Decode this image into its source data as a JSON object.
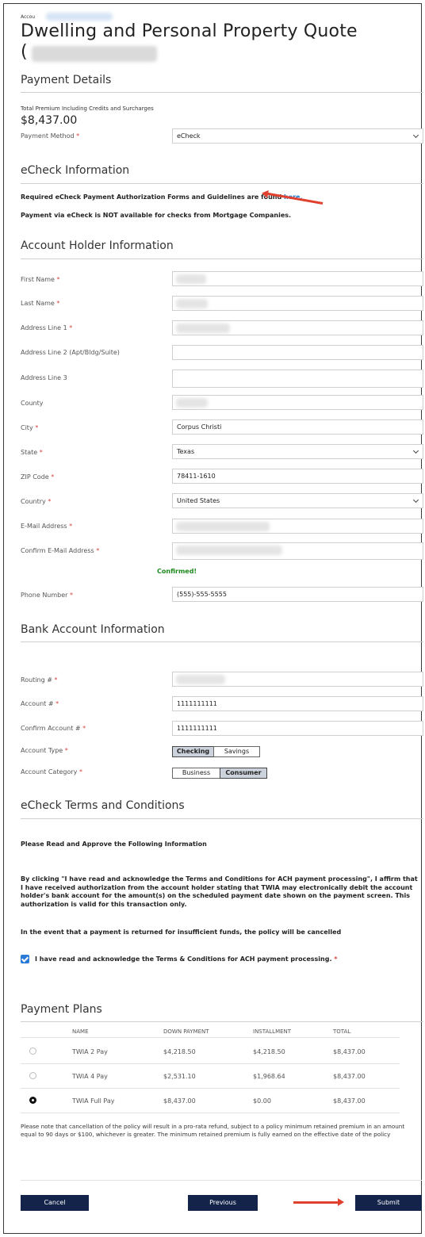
{
  "header": {
    "account_prefix": "Accou",
    "title_line1": "Dwelling and Personal Property Quote",
    "title_line2": "("
  },
  "payment_details": {
    "section_title": "Payment Details",
    "premium_label": "Total Premium Including Credits and Surcharges",
    "premium_value": "$8,437.00",
    "method_label": "Payment Method",
    "method_value": "eCheck"
  },
  "echeck_info": {
    "section_title": "eCheck Information",
    "line1_text": "Required eCheck Payment Authorization Forms and Guidelines are found ",
    "line1_link": "here.",
    "line2_text": "Payment via eCheck is NOT available for checks from Mortgage Companies."
  },
  "account_holder": {
    "section_title": "Account Holder Information",
    "fields": {
      "first_name": {
        "label": "First Name",
        "value": ""
      },
      "last_name": {
        "label": "Last Name",
        "value": ""
      },
      "address1": {
        "label": "Address Line 1",
        "value": ""
      },
      "address2": {
        "label": "Address Line 2 (Apt/Bldg/Suite)",
        "value": ""
      },
      "address3": {
        "label": "Address Line 3",
        "value": ""
      },
      "county": {
        "label": "County",
        "value": ""
      },
      "city": {
        "label": "City",
        "value": "Corpus Christi"
      },
      "state": {
        "label": "State",
        "value": "Texas"
      },
      "zip": {
        "label": "ZIP Code",
        "value": "78411-1610"
      },
      "country": {
        "label": "Country",
        "value": "United States"
      },
      "email": {
        "label": "E-Mail Address",
        "value": ""
      },
      "confirm_email": {
        "label": "Confirm E-Mail Address",
        "value": ""
      },
      "phone": {
        "label": "Phone Number",
        "value": "(555)-555-5555"
      }
    },
    "confirmed_text": "Confirmed!"
  },
  "bank_account": {
    "section_title": "Bank Account Information",
    "routing": {
      "label": "Routing #",
      "value": ""
    },
    "account": {
      "label": "Account #",
      "value": "1111111111"
    },
    "confirm_account": {
      "label": "Confirm Account #",
      "value": "1111111111"
    },
    "type": {
      "label": "Account Type",
      "options": [
        "Checking",
        "Savings"
      ],
      "selected": "Checking"
    },
    "category": {
      "label": "Account Category",
      "options": [
        "Business",
        "Consumer"
      ],
      "selected": "Consumer"
    }
  },
  "terms": {
    "section_title": "eCheck Terms and Conditions",
    "read_approve": "Please Read and Approve the Following Information",
    "paragraph1": "By clicking \"I have read and acknowledge the Terms and Conditions for ACH payment processing\", I affirm that I have received authorization from the account holder stating that TWIA may electronically debit the account holder's bank account for the amount(s) on the scheduled payment date shown on the payment screen. This authorization is valid for this transaction only.",
    "paragraph2": "In the event that a payment is returned for insufficient funds, the policy will be cancelled",
    "ack_label": "I have read and acknowledge the Terms & Conditions for ACH payment processing.",
    "ack_checked": true
  },
  "payment_plans": {
    "section_title": "Payment Plans",
    "columns": [
      "NAME",
      "DOWN PAYMENT",
      "INSTALLMENT",
      "TOTAL"
    ],
    "rows": [
      {
        "name": "TWIA 2 Pay",
        "down": "$4,218.50",
        "installment": "$4,218.50",
        "total": "$8,437.00",
        "selected": false
      },
      {
        "name": "TWIA 4 Pay",
        "down": "$2,531.10",
        "installment": "$1,968.64",
        "total": "$8,437.00",
        "selected": false
      },
      {
        "name": "TWIA Full Pay",
        "down": "$8,437.00",
        "installment": "$0.00",
        "total": "$8,437.00",
        "selected": true
      }
    ],
    "note": "Please note that cancellation of the policy will result in a pro-rata refund, subject to a policy minimum retained premium in an amount equal to 90 days or $100, whichever is greater. The minimum retained premium is fully earned on the effective date of the policy"
  },
  "footer": {
    "cancel_label": "Cancel",
    "previous_label": "Previous",
    "submit_label": "Submit"
  },
  "colors": {
    "button_bg": "#13234a",
    "required": "#d6453d",
    "link": "#1a73c9",
    "confirmed": "#1e8a1e",
    "annotation_arrow": "#e0412f"
  }
}
